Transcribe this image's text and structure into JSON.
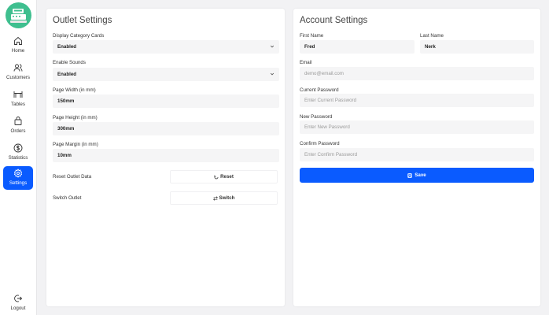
{
  "sidebar": {
    "items": [
      {
        "label": "Home",
        "icon": "home-icon"
      },
      {
        "label": "Customers",
        "icon": "users-icon"
      },
      {
        "label": "Tables",
        "icon": "table-icon"
      },
      {
        "label": "Orders",
        "icon": "bag-icon"
      },
      {
        "label": "Statistics",
        "icon": "dollar-icon"
      },
      {
        "label": "Settings",
        "icon": "gear-icon",
        "active": true
      }
    ],
    "logout_label": "Logout"
  },
  "outlet": {
    "title": "Outlet Settings",
    "display_category_cards": {
      "label": "Display Category Cards",
      "value": "Enabled"
    },
    "enable_sounds": {
      "label": "Enable Sounds",
      "value": "Enabled"
    },
    "page_width": {
      "label": "Page Width (in mm)",
      "value": "150mm"
    },
    "page_height": {
      "label": "Page Height (in mm)",
      "value": "300mm"
    },
    "page_margin": {
      "label": "Page Margin (in mm)",
      "value": "10mm"
    },
    "reset": {
      "label": "Reset Outlet Data",
      "button": "Reset"
    },
    "switch": {
      "label": "Switch Outlet",
      "button": "Switch"
    }
  },
  "account": {
    "title": "Account Settings",
    "first_name": {
      "label": "First Name",
      "value": "Fred"
    },
    "last_name": {
      "label": "Last Name",
      "value": "Nerk"
    },
    "email": {
      "label": "Email",
      "placeholder": "demo@email.com"
    },
    "current_password": {
      "label": "Current Password",
      "placeholder": "Enter Current Password"
    },
    "new_password": {
      "label": "New Password",
      "placeholder": "Enter New Password"
    },
    "confirm_password": {
      "label": "Confirm Password",
      "placeholder": "Enter Confirm Password"
    },
    "save_label": "Save"
  },
  "colors": {
    "accent": "#0a5bff",
    "logo_bg": "#3fbf8f",
    "background": "#f2f2f4"
  }
}
